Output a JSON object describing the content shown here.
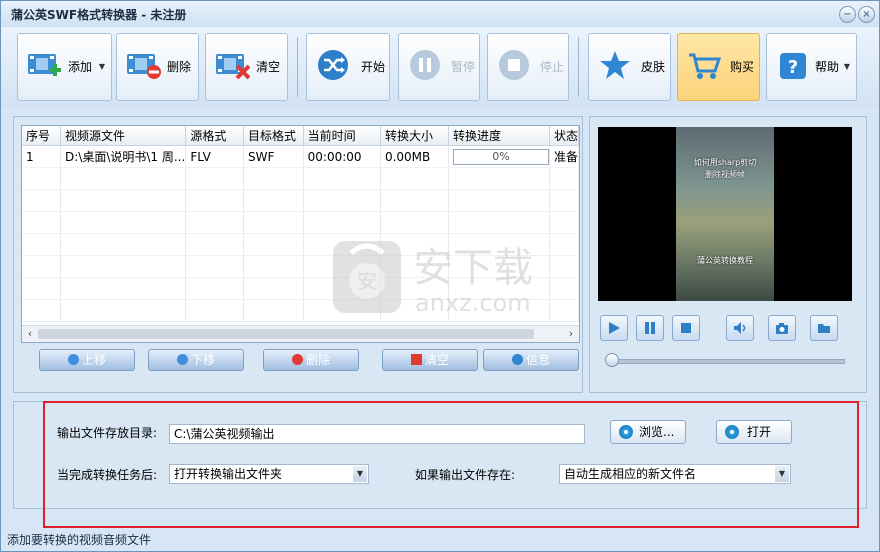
{
  "window": {
    "title": "蒲公英SWF格式转换器 - 未注册"
  },
  "toolbar": {
    "add": "添加",
    "delete": "删除",
    "clear": "清空",
    "start": "开始",
    "pause": "暂停",
    "stop": "停止",
    "skin": "皮肤",
    "buy": "购买",
    "help": "帮助"
  },
  "table": {
    "columns": [
      "序号",
      "视频源文件",
      "源格式",
      "目标格式",
      "当前时间",
      "转换大小",
      "转换进度",
      "状态"
    ],
    "rows": [
      {
        "index": "1",
        "file": "D:\\桌面\\说明书\\1 周...",
        "src": "FLV",
        "dst": "SWF",
        "time": "00:00:00",
        "size": "0.00MB",
        "progress": "0%",
        "status": "准备"
      }
    ]
  },
  "list_buttons": {
    "up": "上移",
    "down": "下移",
    "delete": "删除",
    "clear": "清空",
    "info": "信息"
  },
  "preview": {
    "line1": "如何用sharp剪切",
    "line2": "删除视频帧",
    "caption": "蒲公英转换教程"
  },
  "output": {
    "dir_label": "输出文件存放目录:",
    "dir_value": "C:\\蒲公英视频输出",
    "browse": "浏览...",
    "open": "打开",
    "after_label": "当完成转换任务后:",
    "after_value": "打开转换输出文件夹",
    "exists_label": "如果输出文件存在:",
    "exists_value": "自动生成相应的新文件名"
  },
  "watermark": {
    "name": "安下载",
    "domain": "anxz.com"
  },
  "status_bar": "添加要转换的视频音频文件",
  "colors": {
    "highlight_box": "#e0202a",
    "buy_active": "#fcd37a"
  }
}
